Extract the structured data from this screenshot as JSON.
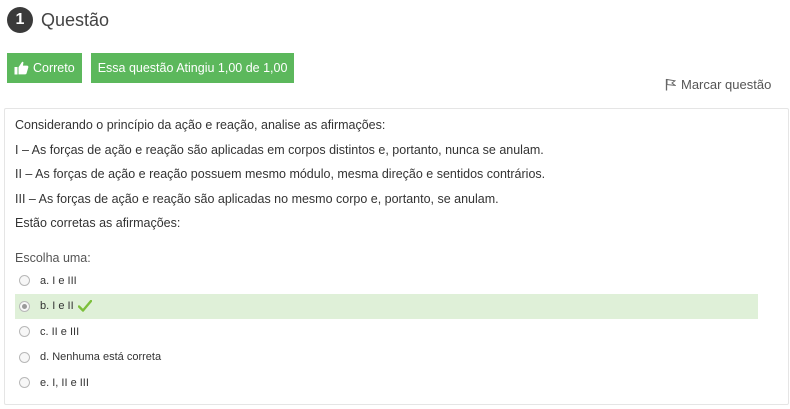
{
  "question": {
    "number": "1",
    "title": "Questão"
  },
  "status": {
    "result_label": "Correto",
    "grade_label": "Essa questão Atingiu 1,00 de 1,00"
  },
  "flag": {
    "label": "Marcar questão"
  },
  "question_text": {
    "intro": "Considerando o princípio da ação e reação, analise as afirmações:",
    "statements": [
      "I – As forças de ação e reação são aplicadas em corpos distintos e, portanto, nunca se anulam.",
      "II – As forças de ação e reação possuem mesmo módulo, mesma direção e sentidos contrários.",
      "III – As forças de ação e reação são aplicadas no mesmo corpo e, portanto, se anulam."
    ],
    "question": "Estão corretas as afirmações:"
  },
  "answers": {
    "prompt": "Escolha uma:",
    "options": [
      {
        "label": "a. I e III",
        "selected": false,
        "correct": false
      },
      {
        "label": "b. I e II",
        "selected": true,
        "correct": true
      },
      {
        "label": "c. II e III",
        "selected": false,
        "correct": false
      },
      {
        "label": "d. Nenhuma está correta",
        "selected": false,
        "correct": false
      },
      {
        "label": "e. I, II e III",
        "selected": false,
        "correct": false
      }
    ]
  },
  "icons": {
    "thumbs_up": "thumbs-up-icon",
    "flag": "flag-icon",
    "check": "checkmark-icon"
  },
  "colors": {
    "badge_green": "#5cb85c",
    "correct_row_bg": "#dff0d8",
    "check_green": "#7cbf3b"
  }
}
